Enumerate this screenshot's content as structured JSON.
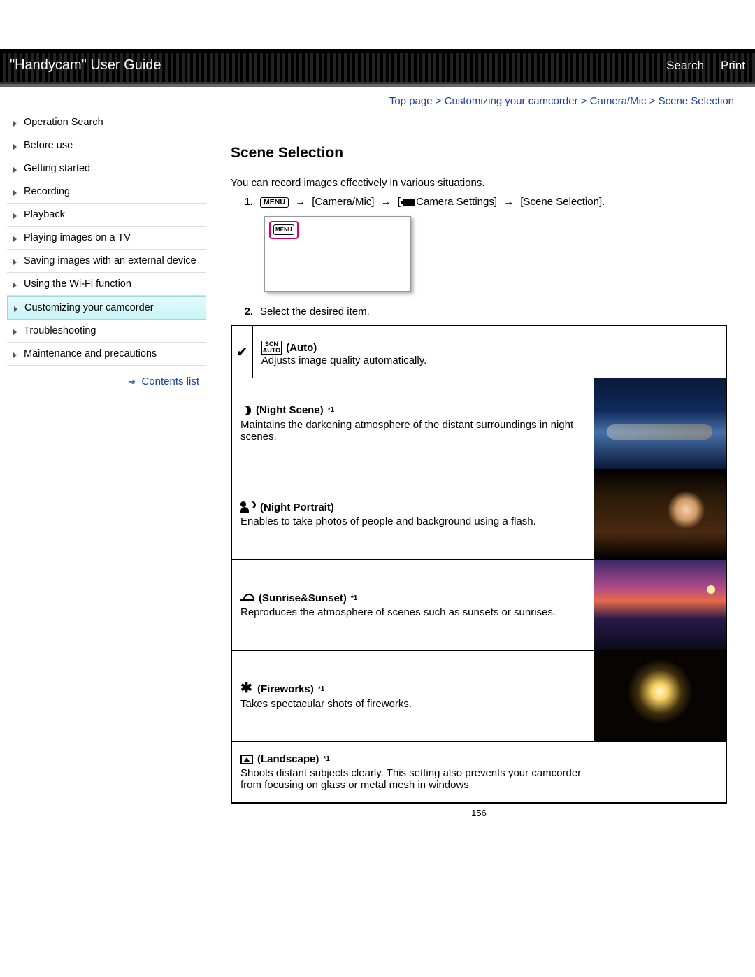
{
  "header": {
    "title": "\"Handycam\" User Guide",
    "search_label": "Search",
    "print_label": "Print"
  },
  "breadcrumb": "Top page > Customizing your camcorder > Camera/Mic > Scene Selection",
  "sidebar": {
    "items": [
      "Operation Search",
      "Before use",
      "Getting started",
      "Recording",
      "Playback",
      "Playing images on a TV",
      "Saving images with an external device",
      "Using the Wi-Fi function",
      "Customizing your camcorder",
      "Troubleshooting",
      "Maintenance and precautions"
    ],
    "active_index": 8,
    "contents_link": "Contents list"
  },
  "main": {
    "heading": "Scene Selection",
    "intro": "You can record images effectively in various situations.",
    "step1": {
      "num": "1.",
      "menu": "MENU",
      "path1": "[Camera/Mic]",
      "path2": "Camera Settings]",
      "path3": "[Scene Selection]."
    },
    "step2": {
      "num": "2.",
      "text": "Select the desired item."
    },
    "rows": [
      {
        "check": "✔",
        "title": "(Auto)",
        "desc": "Adjusts image quality automatically.",
        "icon": "auto-icon",
        "has_image": false
      },
      {
        "title": "(Night Scene)",
        "sup": "*1",
        "desc": "Maintains the darkening atmosphere of the distant surroundings in night scenes.",
        "icon": "moon-icon",
        "has_image": true,
        "img_class": "g-night-city"
      },
      {
        "title": "(Night Portrait)",
        "desc": "Enables to take photos of people and background using a flash.",
        "icon": "night-portrait-icon",
        "has_image": true,
        "img_class": "g-night-portrait"
      },
      {
        "title": "(Sunrise&Sunset)",
        "sup": "*1",
        "desc": "Reproduces the atmosphere of scenes such as sunsets or sunrises.",
        "icon": "sunrise-sunset-icon",
        "has_image": true,
        "img_class": "g-sunset"
      },
      {
        "title": "(Fireworks)",
        "sup": "*1",
        "desc": "Takes spectacular shots of fireworks.",
        "icon": "fireworks-icon",
        "has_image": true,
        "img_class": "g-fireworks"
      },
      {
        "title": "(Landscape)",
        "sup": "*1",
        "desc": "Shoots distant subjects clearly. This setting also prevents your camcorder from focusing on glass or metal mesh in windows",
        "icon": "landscape-icon",
        "has_image": false,
        "no_bottom": true
      }
    ],
    "page_number": "156"
  }
}
